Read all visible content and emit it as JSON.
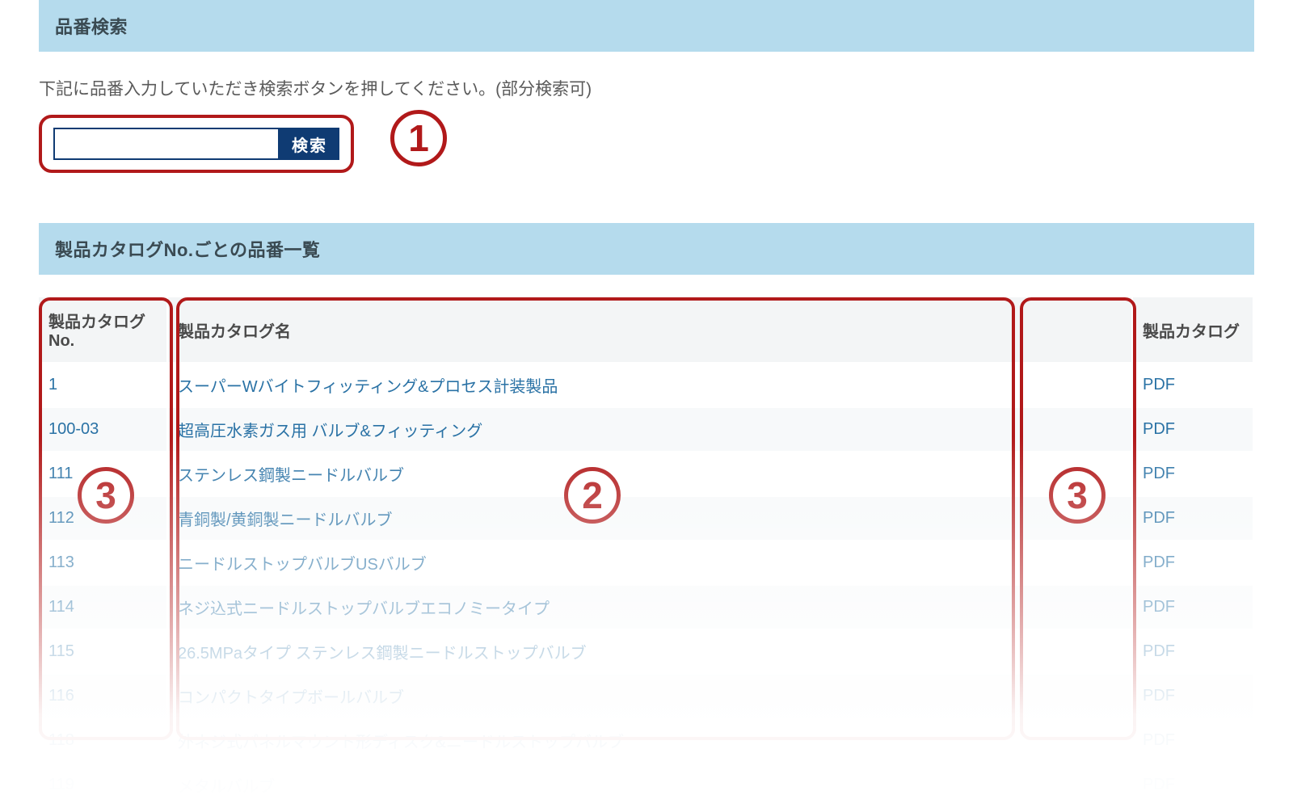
{
  "colors": {
    "accent_red": "#b1191a",
    "header_bg": "#b5dbed",
    "link_blue": "#2a72a5",
    "btn_blue": "#0f3b73"
  },
  "sections": {
    "search_title": "品番検索",
    "list_title": "製品カタログNo.ごとの品番一覧"
  },
  "instruction": "下記に品番入力していただき検索ボタンを押してください。(部分検索可)",
  "search": {
    "placeholder": "",
    "value": "",
    "button_label": "検索"
  },
  "callouts": {
    "c1": "1",
    "c2": "2",
    "c3a": "3",
    "c3b": "3"
  },
  "table": {
    "headers": {
      "no": "製品カタログNo.",
      "name": "製品カタログ名",
      "pdf": "製品カタログ"
    },
    "rows": [
      {
        "no": "1",
        "name": "スーパーWバイトフィッティング&プロセス計装製品",
        "pdf": "PDF"
      },
      {
        "no": "100-03",
        "name": "超高圧水素ガス用 バルブ&フィッティング",
        "pdf": "PDF"
      },
      {
        "no": "111",
        "name": "ステンレス鋼製ニードルバルブ",
        "pdf": "PDF"
      },
      {
        "no": "112",
        "name": "青銅製/黄銅製ニードルバルブ",
        "pdf": "PDF"
      },
      {
        "no": "113",
        "name": "ニードルストップバルブUSバルブ",
        "pdf": "PDF"
      },
      {
        "no": "114",
        "name": "ネジ込式ニードルストップバルブエコノミータイプ",
        "pdf": "PDF"
      },
      {
        "no": "115",
        "name": "26.5MPaタイプ ステンレス鋼製ニードルストップバルブ",
        "pdf": "PDF"
      },
      {
        "no": "116",
        "name": "コンパクトタイプボールバルブ",
        "pdf": "PDF"
      },
      {
        "no": "118",
        "name": "外ネジ式パネルマウント形ディスク&ニードルストップバルブ",
        "pdf": "PDF"
      },
      {
        "no": "119",
        "name": "メタルバルブ",
        "pdf": "PDF"
      }
    ]
  }
}
